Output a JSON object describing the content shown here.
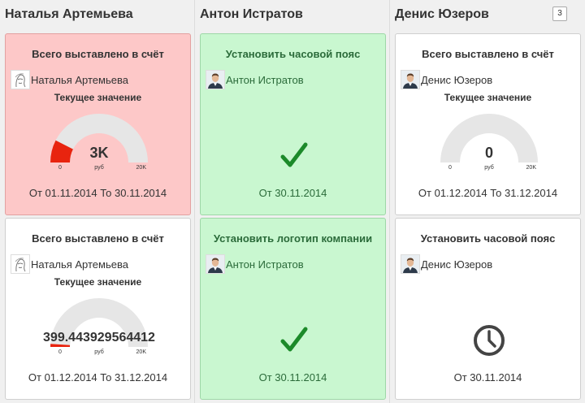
{
  "colors": {
    "red_card": "#fdc8c8",
    "green_card": "#c9f7d0",
    "check_green": "#1c8a2a",
    "gauge_fill": "#e8240f",
    "gauge_track": "#e6e6e6",
    "clock": "#444444"
  },
  "columns": [
    {
      "name": "Наталья Артемьева",
      "cards": [
        {
          "title": "Всего выставлено в счёт",
          "assignee": "Наталья Артемьева",
          "avatar_icon": "sketch-portrait-icon",
          "subtitle": "Текущее значение",
          "gauge": {
            "value_label": "3K",
            "min_label": "0",
            "max_label": "20K",
            "unit": "руб",
            "fraction": 0.15
          },
          "period": "От 01.11.2014 То 30.11.2014"
        },
        {
          "title": "Всего выставлено в счёт",
          "assignee": "Наталья Артемьева",
          "avatar_icon": "sketch-portrait-icon",
          "subtitle": "Текущее значение",
          "gauge": {
            "value_label": "399.443929564412",
            "min_label": "0",
            "max_label": "20K",
            "unit": "руб",
            "fraction": 0.02
          },
          "period": "От 01.12.2014 То 31.12.2014"
        }
      ]
    },
    {
      "name": "Антон Истратов",
      "cards": [
        {
          "title": "Установить часовой пояс",
          "assignee": "Антон Истратов",
          "avatar_icon": "man-portrait-icon",
          "status_icon": "checkmark-icon",
          "period": "От 30.11.2014"
        },
        {
          "title": "Установить логотип компании",
          "assignee": "Антон Истратов",
          "avatar_icon": "man-portrait-icon",
          "status_icon": "checkmark-icon",
          "period": "От 30.11.2014"
        }
      ]
    },
    {
      "name": "Денис Юзеров",
      "badge": "3",
      "cards": [
        {
          "title": "Всего выставлено в счёт",
          "assignee": "Денис Юзеров",
          "avatar_icon": "man-portrait-icon",
          "subtitle": "Текущее значение",
          "gauge": {
            "value_label": "0",
            "min_label": "0",
            "max_label": "20K",
            "unit": "руб",
            "fraction": 0
          },
          "period": "От 01.12.2014 То 31.12.2014"
        },
        {
          "title": "Установить часовой пояс",
          "assignee": "Денис Юзеров",
          "avatar_icon": "man-portrait-icon",
          "status_icon": "clock-icon",
          "period": "От 30.11.2014"
        }
      ]
    }
  ]
}
